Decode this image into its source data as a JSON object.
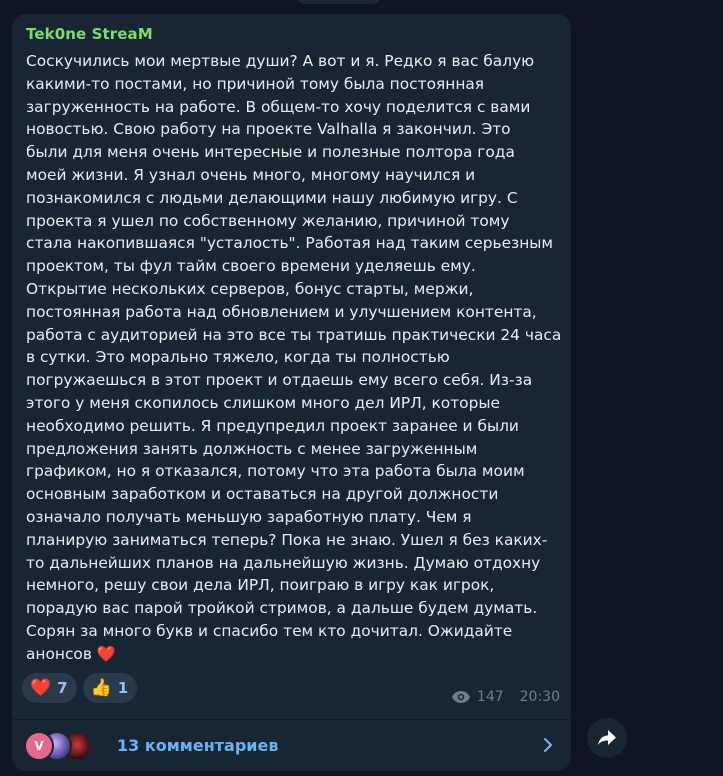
{
  "post": {
    "author": "Tek0ne StreaM",
    "text": "Соскучились мои мертвые души? А вот и я. Редко я вас балую\nкакими-то постами, но причиной тому была постоянная\nзагруженность на работе. В общем-то хочу поделится с вами\nновостью. Свою работу на проекте Valhalla я закончил. Это\nбыли для меня очень интересные и полезные полтора года\nмоей жизни. Я узнал очень много, многому научился и\nпознакомился с  людьми делающими нашу любимую игру. С\nпроекта я ушел по собственному желанию, причиной тому\nстала накопившаяся \"усталость\". Работая над таким серьезным\nпроектом, ты фул тайм своего времени уделяешь ему.\nОткрытие нескольких серверов, бонус старты, мержи,\nпостоянная работа над обновлением и улучшением контента,\nработа с аудиторией на это все ты тратишь практически 24 часа\nв сутки. Это морально тяжело, когда ты полностью\nпогружаешься в этот проект и отдаешь ему всего себя. Из-за\nэтого у меня скопилось слишком много дел ИРЛ, которые\nнеобходимо решить. Я предупредил проект заранее и были\nпредложения занять должность с менее загруженным\nграфиком, но я отказался, потому что эта работа была моим\nосновным заработком и оставаться на другой должности\nозначало получать меньшую заработную плату. Чем я\nпланирую заниматься теперь? Пока не знаю. Ушел я без каких-\nто дальнейших планов на дальнейшую жизнь. Думаю отдохну\nнемного, решу свои дела ИРЛ, поиграю в игру как игрок,\nпорадую вас парой тройкой стримов, а дальше будем думать.\nСорян за много букв и спасибо тем кто дочитал. Ожидайте\nанонсов",
    "end_emoji": "❤️",
    "reactions": [
      {
        "emoji": "❤️",
        "count": "7",
        "icon": "heart-icon"
      },
      {
        "emoji": "👍",
        "count": "1",
        "icon": "thumbs-up-icon"
      }
    ],
    "views": "147",
    "time": "20:30",
    "comments": {
      "label": "13 комментариев",
      "first_avatar_letter": "V"
    }
  },
  "colors": {
    "background": "#0e1621",
    "bubble": "#182533",
    "author": "#7fdb6a",
    "link": "#6ab3f3"
  }
}
